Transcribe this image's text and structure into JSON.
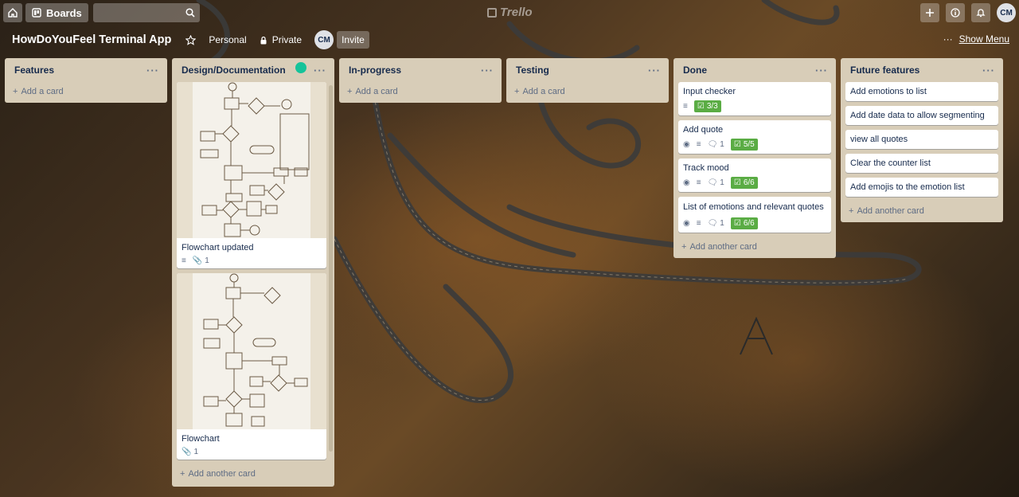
{
  "topbar": {
    "boards_label": "Boards",
    "logo_text": "Trello",
    "avatar_initials": "CM"
  },
  "board": {
    "title": "HowDoYouFeel Terminal App",
    "team": "Personal",
    "visibility": "Private",
    "member_initials": "CM",
    "invite_label": "Invite",
    "show_menu_label": "Show Menu"
  },
  "lists": [
    {
      "title": "Features",
      "add_label": "Add a card"
    },
    {
      "title": "Design/Documentation",
      "cards": [
        {
          "title": "Flowchart updated",
          "attachments": "1"
        },
        {
          "title": "Flowchart",
          "attachments": "1"
        }
      ],
      "add_label": "Add another card"
    },
    {
      "title": "In-progress",
      "add_label": "Add a card"
    },
    {
      "title": "Testing",
      "add_label": "Add a card"
    },
    {
      "title": "Done",
      "cards": [
        {
          "title": "Input checker",
          "checklist": "3/3"
        },
        {
          "title": "Add quote",
          "comments": "1",
          "checklist": "5/5"
        },
        {
          "title": "Track mood",
          "comments": "1",
          "checklist": "6/6"
        },
        {
          "title": "List of emotions and relevant quotes",
          "comments": "1",
          "checklist": "6/6"
        }
      ],
      "add_label": "Add another card"
    },
    {
      "title": "Future features",
      "cards": [
        {
          "title": "Add emotions to list"
        },
        {
          "title": "Add date data to allow segmenting"
        },
        {
          "title": "view all quotes"
        },
        {
          "title": "Clear the counter list"
        },
        {
          "title": "Add emojis to the emotion list"
        }
      ],
      "add_label": "Add another card"
    }
  ],
  "colors": {
    "list_bg": "#d8cdb8",
    "checklist_complete": "#5aac44",
    "text": "#172b4d"
  }
}
